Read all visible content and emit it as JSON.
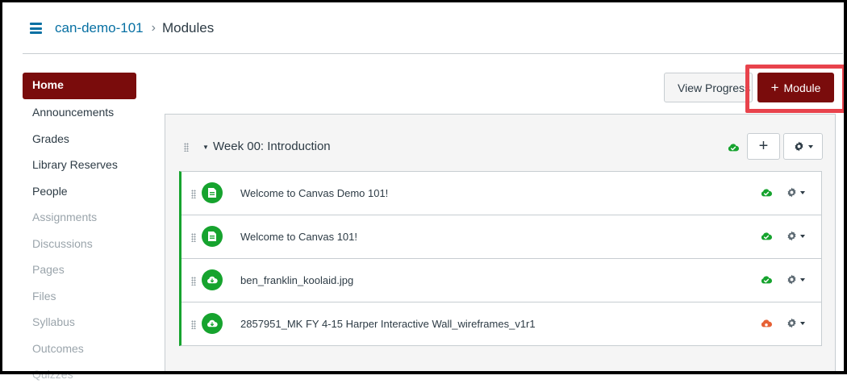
{
  "header": {
    "course": "can-demo-101",
    "separator": "›",
    "page": "Modules"
  },
  "nav": {
    "items": [
      {
        "label": "Home",
        "state": "active"
      },
      {
        "label": "Announcements",
        "state": "enabled"
      },
      {
        "label": "Grades",
        "state": "enabled"
      },
      {
        "label": "Library Reserves",
        "state": "enabled"
      },
      {
        "label": "People",
        "state": "enabled"
      },
      {
        "label": "Assignments",
        "state": "disabled"
      },
      {
        "label": "Discussions",
        "state": "disabled"
      },
      {
        "label": "Pages",
        "state": "disabled"
      },
      {
        "label": "Files",
        "state": "disabled"
      },
      {
        "label": "Syllabus",
        "state": "disabled"
      },
      {
        "label": "Outcomes",
        "state": "disabled"
      },
      {
        "label": "Quizzes",
        "state": "cut"
      }
    ]
  },
  "toolbar": {
    "view_progress": "View Progress",
    "add_module_plus": "+",
    "add_module": "Module"
  },
  "module": {
    "title": "Week 00: Introduction",
    "status": "published",
    "add_symbol": "+",
    "items": [
      {
        "title": "Welcome to Canvas Demo 101!",
        "type": "page-icon",
        "status": "published"
      },
      {
        "title": "Welcome to Canvas 101!",
        "type": "page-icon",
        "status": "published"
      },
      {
        "title": "ben_franklin_koolaid.jpg",
        "type": "download-icon",
        "status": "published"
      },
      {
        "title": "2857951_MK FY 4-15 Harper Interactive Wall_wireframes_v1r1",
        "type": "download-icon",
        "status": "unpublished"
      }
    ]
  },
  "colors": {
    "brand": "#7a0c0c",
    "link": "#0770a3",
    "published": "#16a32e",
    "unpublished": "#e66135",
    "highlight": "#e8434c"
  }
}
